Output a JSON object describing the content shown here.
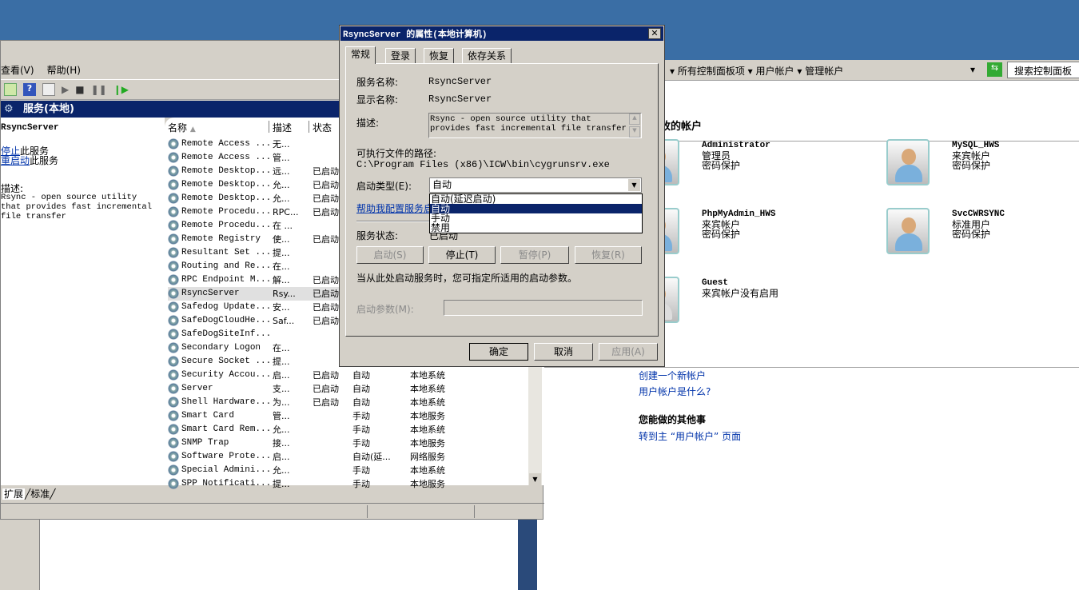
{
  "services_window": {
    "menu": [
      "查看(V)",
      "帮助(H)"
    ],
    "header": "服务(本地)",
    "selected_service": "RsyncServer",
    "stop_link": "停止",
    "stop_suffix": "此服务",
    "restart_link": "重启动",
    "restart_suffix": "此服务",
    "desc_label": "描述:",
    "description": "Rsync - open source utility that provides fast incremental file transfer",
    "columns": [
      "名称",
      "描述",
      "状态"
    ],
    "rows": [
      {
        "name": "Remote Access ...",
        "desc": "无...",
        "status": "",
        "startup": "",
        "logon": ""
      },
      {
        "name": "Remote Access ...",
        "desc": "管...",
        "status": "",
        "startup": "",
        "logon": ""
      },
      {
        "name": "Remote Desktop...",
        "desc": "远...",
        "status": "已启动",
        "startup": "",
        "logon": ""
      },
      {
        "name": "Remote Desktop...",
        "desc": "允...",
        "status": "已启动",
        "startup": "",
        "logon": ""
      },
      {
        "name": "Remote Desktop...",
        "desc": "允...",
        "status": "已启动",
        "startup": "",
        "logon": ""
      },
      {
        "name": "Remote Procedu...",
        "desc": "RPC...",
        "status": "已启动",
        "startup": "",
        "logon": ""
      },
      {
        "name": "Remote Procedu...",
        "desc": "在 ...",
        "status": "",
        "startup": "",
        "logon": ""
      },
      {
        "name": "Remote Registry",
        "desc": "使...",
        "status": "已启动",
        "startup": "",
        "logon": ""
      },
      {
        "name": "Resultant Set ...",
        "desc": "提...",
        "status": "",
        "startup": "",
        "logon": ""
      },
      {
        "name": "Routing and Re...",
        "desc": "在...",
        "status": "",
        "startup": "",
        "logon": ""
      },
      {
        "name": "RPC Endpoint M...",
        "desc": "解...",
        "status": "已启动",
        "startup": "",
        "logon": ""
      },
      {
        "name": "RsyncServer",
        "desc": "Rsy...",
        "status": "已启动",
        "startup": "",
        "logon": ""
      },
      {
        "name": "Safedog Update...",
        "desc": "安...",
        "status": "已启动",
        "startup": "",
        "logon": ""
      },
      {
        "name": "SafeDogCloudHe...",
        "desc": "Saf...",
        "status": "已启动",
        "startup": "",
        "logon": ""
      },
      {
        "name": "SafeDogSiteInf...",
        "desc": "",
        "status": "",
        "startup": "",
        "logon": ""
      },
      {
        "name": "Secondary Logon",
        "desc": "在...",
        "status": "",
        "startup": "",
        "logon": ""
      },
      {
        "name": "Secure Socket ...",
        "desc": "提...",
        "status": "",
        "startup": "",
        "logon": ""
      },
      {
        "name": "Security Accou...",
        "desc": "启...",
        "status": "已启动",
        "startup": "自动",
        "logon": "本地系统"
      },
      {
        "name": "Server",
        "desc": "支...",
        "status": "已启动",
        "startup": "自动",
        "logon": "本地系统"
      },
      {
        "name": "Shell Hardware...",
        "desc": "为...",
        "status": "已启动",
        "startup": "自动",
        "logon": "本地系统"
      },
      {
        "name": "Smart Card",
        "desc": "管...",
        "status": "",
        "startup": "手动",
        "logon": "本地服务"
      },
      {
        "name": "Smart Card Rem...",
        "desc": "允...",
        "status": "",
        "startup": "手动",
        "logon": "本地系统"
      },
      {
        "name": "SNMP Trap",
        "desc": "接...",
        "status": "",
        "startup": "手动",
        "logon": "本地服务"
      },
      {
        "name": "Software Prote...",
        "desc": "启...",
        "status": "",
        "startup": "自动(延...",
        "logon": "网络服务"
      },
      {
        "name": "Special Admini...",
        "desc": "允...",
        "status": "",
        "startup": "手动",
        "logon": "本地系统"
      },
      {
        "name": "SPP Notificati...",
        "desc": "提...",
        "status": "",
        "startup": "手动",
        "logon": "本地服务"
      }
    ],
    "bottom_tabs": [
      "扩展",
      "标准"
    ]
  },
  "dialog": {
    "title": "RsyncServer 的属性(本地计算机)",
    "tabs": [
      "常规",
      "登录",
      "恢复",
      "依存关系"
    ],
    "service_name_label": "服务名称:",
    "service_name": "RsyncServer",
    "display_name_label": "显示名称:",
    "display_name": "RsyncServer",
    "desc_label": "描述:",
    "description": "Rsync - open source utility that provides fast incremental file transfer",
    "path_label": "可执行文件的路径:",
    "path": "C:\\Program Files (x86)\\ICW\\bin\\cygrunsrv.exe",
    "startup_label": "启动类型(E):",
    "startup_value": "自动",
    "startup_options": [
      "自动(延迟启动)",
      "自动",
      "手动",
      "禁用"
    ],
    "help_link": "帮助我配置服务启",
    "status_label": "服务状态:",
    "status_value": "已启动",
    "buttons": {
      "start": "启动(S)",
      "stop": "停止(T)",
      "pause": "暂停(P)",
      "resume": "恢复(R)"
    },
    "hint": "当从此处启动服务时，您可指定所适用的启动参数。",
    "params_label": "启动参数(M):",
    "params_value": "",
    "ok": "确定",
    "cancel": "取消",
    "apply": "应用(A)"
  },
  "control_panel": {
    "breadcrumb": [
      "所有控制面板项",
      "用户帐户",
      "管理帐户"
    ],
    "search_placeholder": "搜索控制面板",
    "heading": "希望更改的帐户",
    "accounts": [
      {
        "name": "Administrator",
        "lines": [
          "管理员",
          "密码保护"
        ]
      },
      {
        "name": "MySQL_HWS",
        "lines": [
          "来宾帐户",
          "密码保护"
        ]
      },
      {
        "name": "PhpMyAdmin_HWS",
        "lines": [
          "来宾帐户",
          "密码保护"
        ]
      },
      {
        "name": "SvcCWRSYNC",
        "lines": [
          "标准用户",
          "密码保护"
        ]
      },
      {
        "name": "Guest",
        "lines": [
          "来宾帐户没有启用"
        ]
      }
    ],
    "links": [
      "创建一个新帐户",
      "用户帐户是什么?"
    ],
    "other_heading": "您能做的其他事",
    "other_links": [
      "转到主 “用户帐户” 页面"
    ]
  }
}
